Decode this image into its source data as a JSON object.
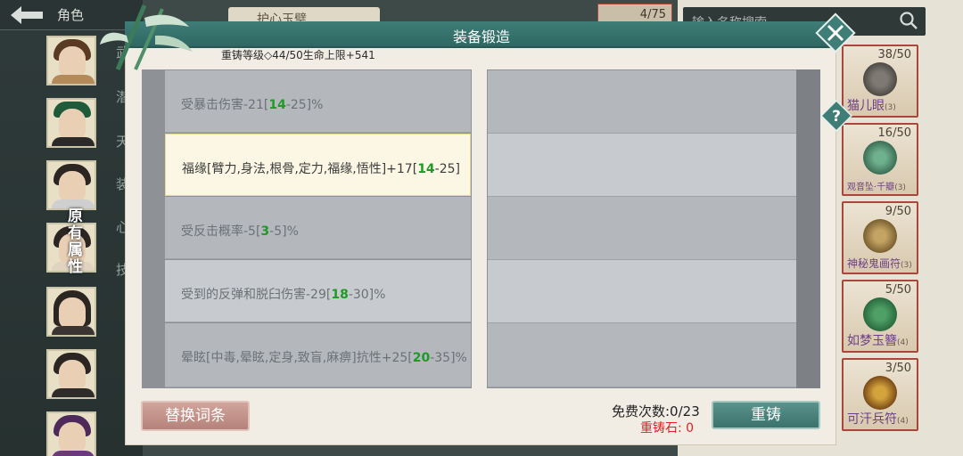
{
  "background": {
    "role_label": "角色",
    "search_placeholder": "输入名称搜索",
    "top_slot": "4/75",
    "top_tab": "护心玉璧",
    "side_text": [
      "武",
      "潜",
      "天",
      "装",
      "心",
      "技"
    ],
    "orig_attr": "原有属性"
  },
  "inventory": [
    {
      "count": "38/50",
      "name": "猫儿眼",
      "sub": "(3)"
    },
    {
      "count": "16/50",
      "name": "观音坠·千瓣",
      "sub": "(3)"
    },
    {
      "count": "9/50",
      "name": "神秘鬼画符",
      "sub": "(3)"
    },
    {
      "count": "5/50",
      "name": "如梦玉簪",
      "sub": "(4)"
    },
    {
      "count": "3/50",
      "name": "可汗兵符",
      "sub": "(4)"
    }
  ],
  "modal": {
    "title": "装备锻造",
    "reforge_level": "重铸等级◇44/50生命上限+541",
    "attributes": [
      {
        "pre": "受暴击伤害-21[",
        "low": "14",
        "post": "-25]%"
      },
      {
        "pre": "福缘[臂力,身法,根骨,定力,福缘,悟性]+17[",
        "low": "14",
        "post": "-25]"
      },
      {
        "pre": "受反击概率-5[",
        "low": "3",
        "post": "-5]%"
      },
      {
        "pre": "受到的反弹和脱臼伤害-29[",
        "low": "18",
        "post": "-30]%"
      },
      {
        "pre": "晕眩[中毒,晕眩,定身,致盲,麻痹]抗性+25[",
        "low": "20",
        "post": "-35]%"
      }
    ],
    "replace_label": "替换词条",
    "reforge_label": "重铸",
    "free_count": "免费次数:0/23",
    "stone_count": "重铸石: 0"
  }
}
